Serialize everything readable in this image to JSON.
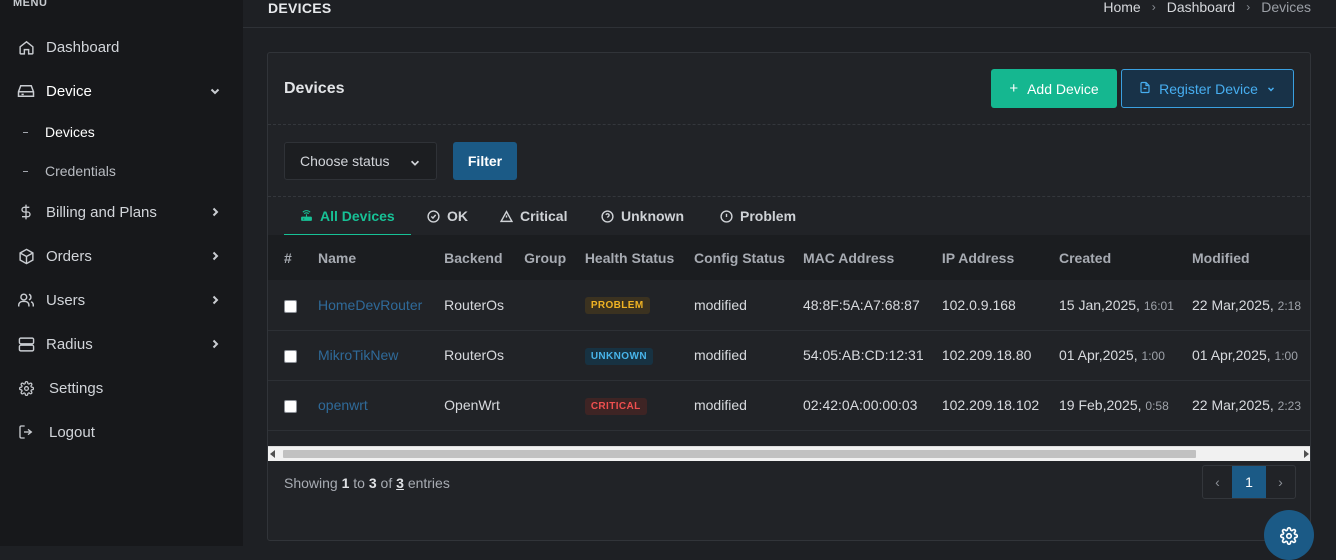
{
  "sidebar": {
    "menu_title": "MENU",
    "items": [
      {
        "label": "Dashboard",
        "icon": "home-icon"
      },
      {
        "label": "Device",
        "icon": "device-icon"
      },
      {
        "label": "Billing and Plans",
        "icon": "dollar-icon"
      },
      {
        "label": "Orders",
        "icon": "box-icon"
      },
      {
        "label": "Users",
        "icon": "users-icon"
      },
      {
        "label": "Radius",
        "icon": "server-icon"
      },
      {
        "label": "Settings",
        "icon": "gear-icon"
      },
      {
        "label": "Logout",
        "icon": "logout-icon"
      }
    ],
    "device_sub": [
      {
        "label": "Devices"
      },
      {
        "label": "Credentials"
      }
    ]
  },
  "header": {
    "title": "DEVICES",
    "breadcrumb": [
      "Home",
      "Dashboard",
      "Devices"
    ]
  },
  "card": {
    "title": "Devices",
    "add_label": "Add Device",
    "register_label": "Register Device"
  },
  "filter": {
    "status_placeholder": "Choose status",
    "button_label": "Filter"
  },
  "tabs": [
    {
      "label": "All Devices",
      "icon": "router-icon"
    },
    {
      "label": "OK",
      "icon": "check-circle-icon"
    },
    {
      "label": "Critical",
      "icon": "warning-icon"
    },
    {
      "label": "Unknown",
      "icon": "question-circle-icon"
    },
    {
      "label": "Problem",
      "icon": "info-circle-icon"
    }
  ],
  "table": {
    "columns": [
      "#",
      "Name",
      "Backend",
      "Group",
      "Health Status",
      "Config Status",
      "MAC Address",
      "IP Address",
      "Created",
      "Modified"
    ],
    "rows": [
      {
        "name": "HomeDevRouter",
        "backend": "RouterOs",
        "group": "",
        "health": "PROBLEM",
        "config": "modified",
        "mac": "48:8F:5A:A7:68:87",
        "ip": "102.0.9.168",
        "created_date": "15 Jan,2025,",
        "created_time": "16:01",
        "modified_date": "22 Mar,2025,",
        "modified_time": "2:18"
      },
      {
        "name": "MikroTikNew",
        "backend": "RouterOs",
        "group": "",
        "health": "UNKNOWN",
        "config": "modified",
        "mac": "54:05:AB:CD:12:31",
        "ip": "102.209.18.80",
        "created_date": "01 Apr,2025,",
        "created_time": "1:00",
        "modified_date": "01 Apr,2025,",
        "modified_time": "1:00"
      },
      {
        "name": "openwrt",
        "backend": "OpenWrt",
        "group": "",
        "health": "CRITICAL",
        "config": "modified",
        "mac": "02:42:0A:00:00:03",
        "ip": "102.209.18.102",
        "created_date": "19 Feb,2025,",
        "created_time": "0:58",
        "modified_date": "22 Mar,2025,",
        "modified_time": "2:23"
      }
    ]
  },
  "footer": {
    "showing_prefix": "Showing",
    "from": "1",
    "to_word": "to",
    "to": "3",
    "of_word": "of",
    "total": "3",
    "suffix": "entries",
    "prev": "‹",
    "page": "1",
    "next": "›"
  },
  "colors": {
    "accent_green": "#15b790",
    "accent_blue": "#1b5a86",
    "problem": "#f0b323",
    "unknown": "#48b4ea",
    "critical": "#ee4f4f"
  }
}
